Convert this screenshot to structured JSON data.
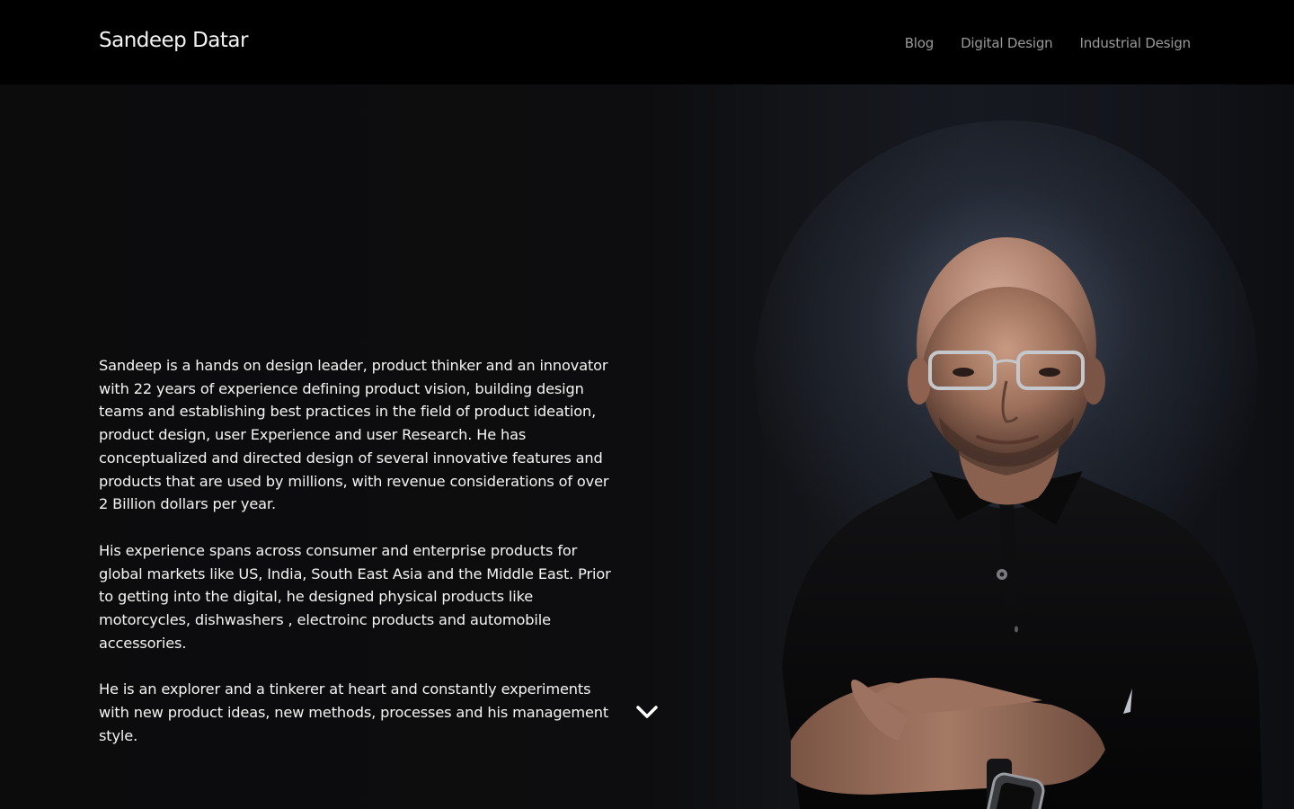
{
  "header": {
    "brand": "Sandeep Datar",
    "nav": [
      {
        "label": "Blog"
      },
      {
        "label": "Digital Design"
      },
      {
        "label": "Industrial Design"
      }
    ]
  },
  "about": {
    "paragraphs": [
      " Sandeep is a hands on design leader, product thinker and an innovator\nwith 22 years of experience defining product vision, building design\nteams and establishing best practices in the field of product ideation,\nproduct design, user Experience and user Research. He has\nconceptualized and directed design of several innovative features and\nproducts that are used by millions, with revenue considerations of over\n2 Billion dollars per year.",
      "His experience spans across consumer and enterprise products for\nglobal markets like US, India, South East Asia and the Middle East. Prior\nto getting into the digital, he designed physical products like\nmotorcycles, dishwashers , electroinc products and automobile\naccessories.",
      "He is an explorer and a tinkerer at heart and  constantly experiments\nwith new product ideas, new methods,  processes and his management\nstyle."
    ]
  },
  "icons": {
    "scroll_down": "chevron-down-icon",
    "watch": "smartwatch-icon",
    "shirt_logo": "sailboat-logo-icon"
  },
  "colors": {
    "header_bg": "#000000",
    "page_bg": "#0b0b0c",
    "text": "#f4f4f4",
    "nav_text": "#9a9a9a"
  }
}
